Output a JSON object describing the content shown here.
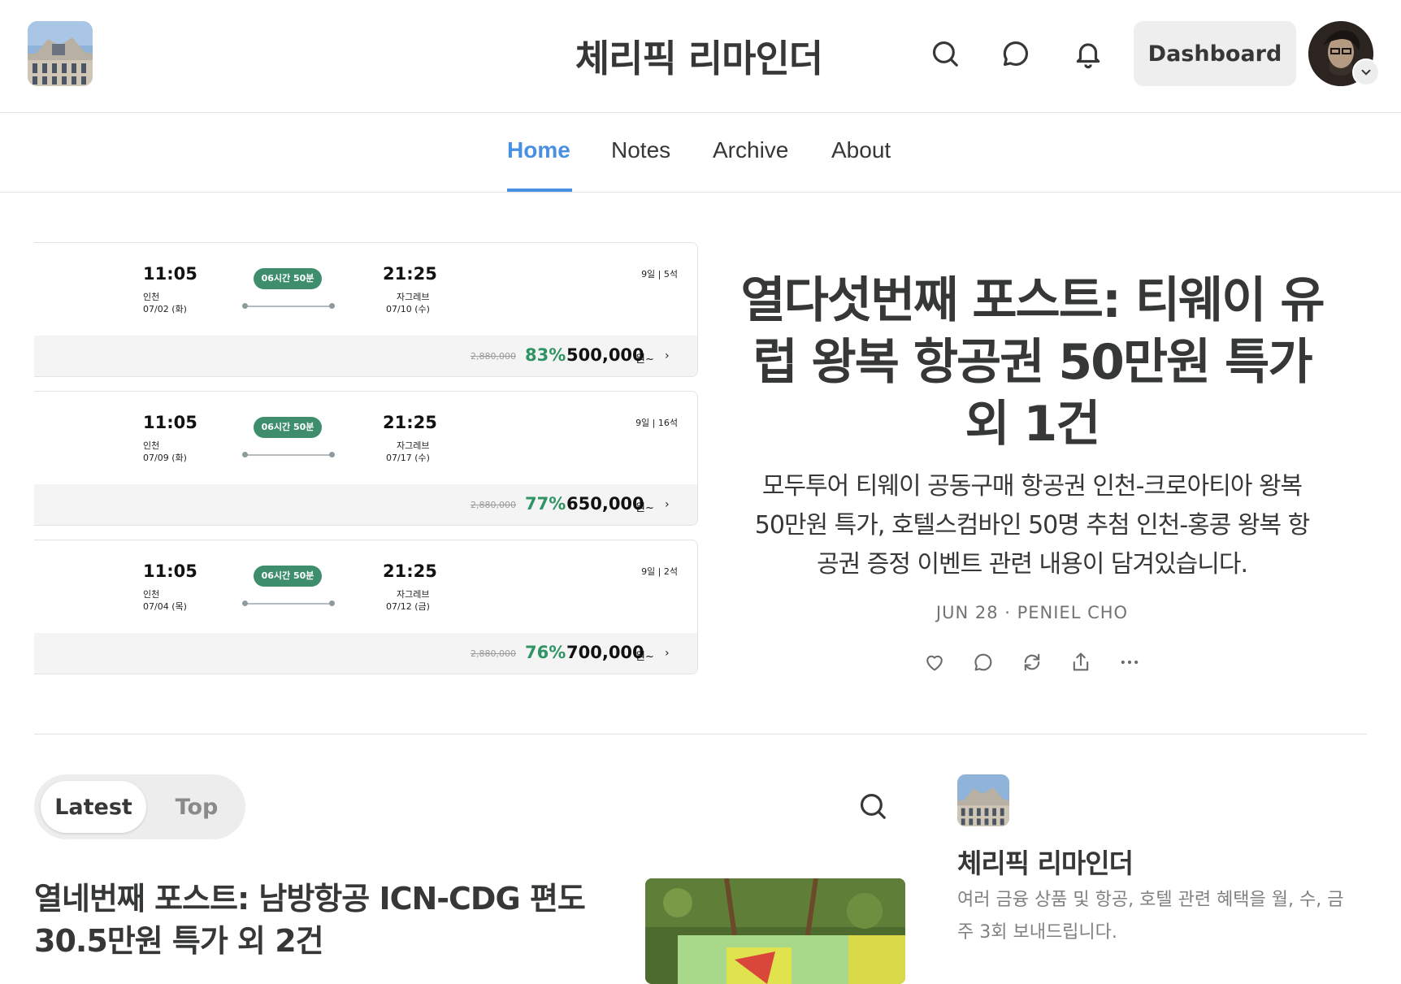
{
  "header": {
    "site_title": "체리픽 리마인더",
    "dashboard_label": "Dashboard"
  },
  "nav": {
    "tabs": [
      {
        "label": "Home",
        "active": true
      },
      {
        "label": "Notes",
        "active": false
      },
      {
        "label": "Archive",
        "active": false
      },
      {
        "label": "About",
        "active": false
      }
    ]
  },
  "hero": {
    "flights": [
      {
        "dep_time": "11:05",
        "dep_city": "인천",
        "dep_date": "07/02 (화)",
        "duration": "06시간 50분",
        "arr_time": "21:25",
        "arr_city": "자그레브",
        "arr_date": "07/10 (수)",
        "seats": "9일 | 5석",
        "orig_price": "2,880,000",
        "discount": "83%",
        "price": "500,000",
        "currency": "원~"
      },
      {
        "dep_time": "11:05",
        "dep_city": "인천",
        "dep_date": "07/09 (화)",
        "duration": "06시간 50분",
        "arr_time": "21:25",
        "arr_city": "자그레브",
        "arr_date": "07/17 (수)",
        "seats": "9일 | 16석",
        "orig_price": "2,880,000",
        "discount": "77%",
        "price": "650,000",
        "currency": "원~"
      },
      {
        "dep_time": "11:05",
        "dep_city": "인천",
        "dep_date": "07/04 (목)",
        "duration": "06시간 50분",
        "arr_time": "21:25",
        "arr_city": "자그레브",
        "arr_date": "07/12 (금)",
        "seats": "9일 | 2석",
        "orig_price": "2,880,000",
        "discount": "76%",
        "price": "700,000",
        "currency": "원~"
      }
    ],
    "title": "열다섯번째 포스트: 티웨이 유럽 왕복 항공권 50만원 특가 외 1건",
    "subtitle": "모두투어 티웨이 공동구매 항공권 인천-크로아티아 왕복 50만원 특가, 호텔스컴바인 50명 추첨 인천-홍콩 왕복 항공권 증정 이벤트 관련 내용이 담겨있습니다.",
    "meta": "JUN 28 · PENIEL CHO"
  },
  "feed": {
    "toggle_latest": "Latest",
    "toggle_top": "Top",
    "post_title": "열네번째 포스트: 남방항공 ICN-CDG 편도 30.5만원 특가 외 2건"
  },
  "sidebar": {
    "name": "체리픽 리마인더",
    "description": "여러 금융 상품 및 항공, 호텔 관련 혜택을 월, 수, 금 주 3회 보내드립니다."
  },
  "colors": {
    "accent": "#4a90e2",
    "discount_green": "#2e9463",
    "duration_pill": "#3e8e6d",
    "text": "#363737"
  }
}
